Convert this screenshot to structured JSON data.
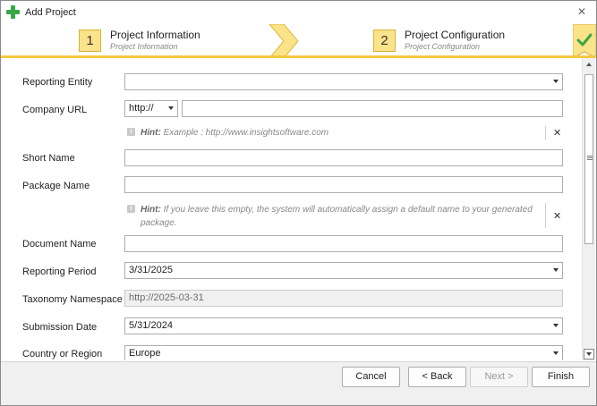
{
  "window": {
    "title": "Add Project",
    "close_glyph": "✕"
  },
  "steps": [
    {
      "number": "1",
      "title": "Project Information",
      "subtitle": "Project Information"
    },
    {
      "number": "2",
      "title": "Project Configuration",
      "subtitle": "Project Configuration"
    }
  ],
  "step_complete_icon": "check-icon",
  "fields": {
    "reporting_entity": {
      "label": "Reporting Entity",
      "value": ""
    },
    "company_url": {
      "label": "Company URL",
      "protocol": "http://",
      "value": ""
    },
    "url_hint": {
      "label": "Hint:",
      "text": "Example : http://www.insightsoftware.com"
    },
    "short_name": {
      "label": "Short Name",
      "value": ""
    },
    "package_name": {
      "label": "Package Name",
      "value": ""
    },
    "package_hint": {
      "label": "Hint:",
      "text": "If you leave this empty, the system will automatically assign a default name to your generated package."
    },
    "document_name": {
      "label": "Document Name",
      "value": ""
    },
    "reporting_period": {
      "label": "Reporting Period",
      "value": "3/31/2025"
    },
    "taxonomy_namespace": {
      "label": "Taxonomy Namespace",
      "value": "http://2025-03-31"
    },
    "submission_date": {
      "label": "Submission Date",
      "value": "5/31/2024"
    },
    "country_region": {
      "label": "Country or Region",
      "value": "Europe"
    }
  },
  "hint_close_glyph": "✕",
  "buttons": {
    "cancel": "Cancel",
    "back": "< Back",
    "next": "Next >",
    "finish": "Finish"
  },
  "colors": {
    "accent": "#f5c842",
    "step_badge": "#fbe38a",
    "check": "#3aa64a"
  }
}
